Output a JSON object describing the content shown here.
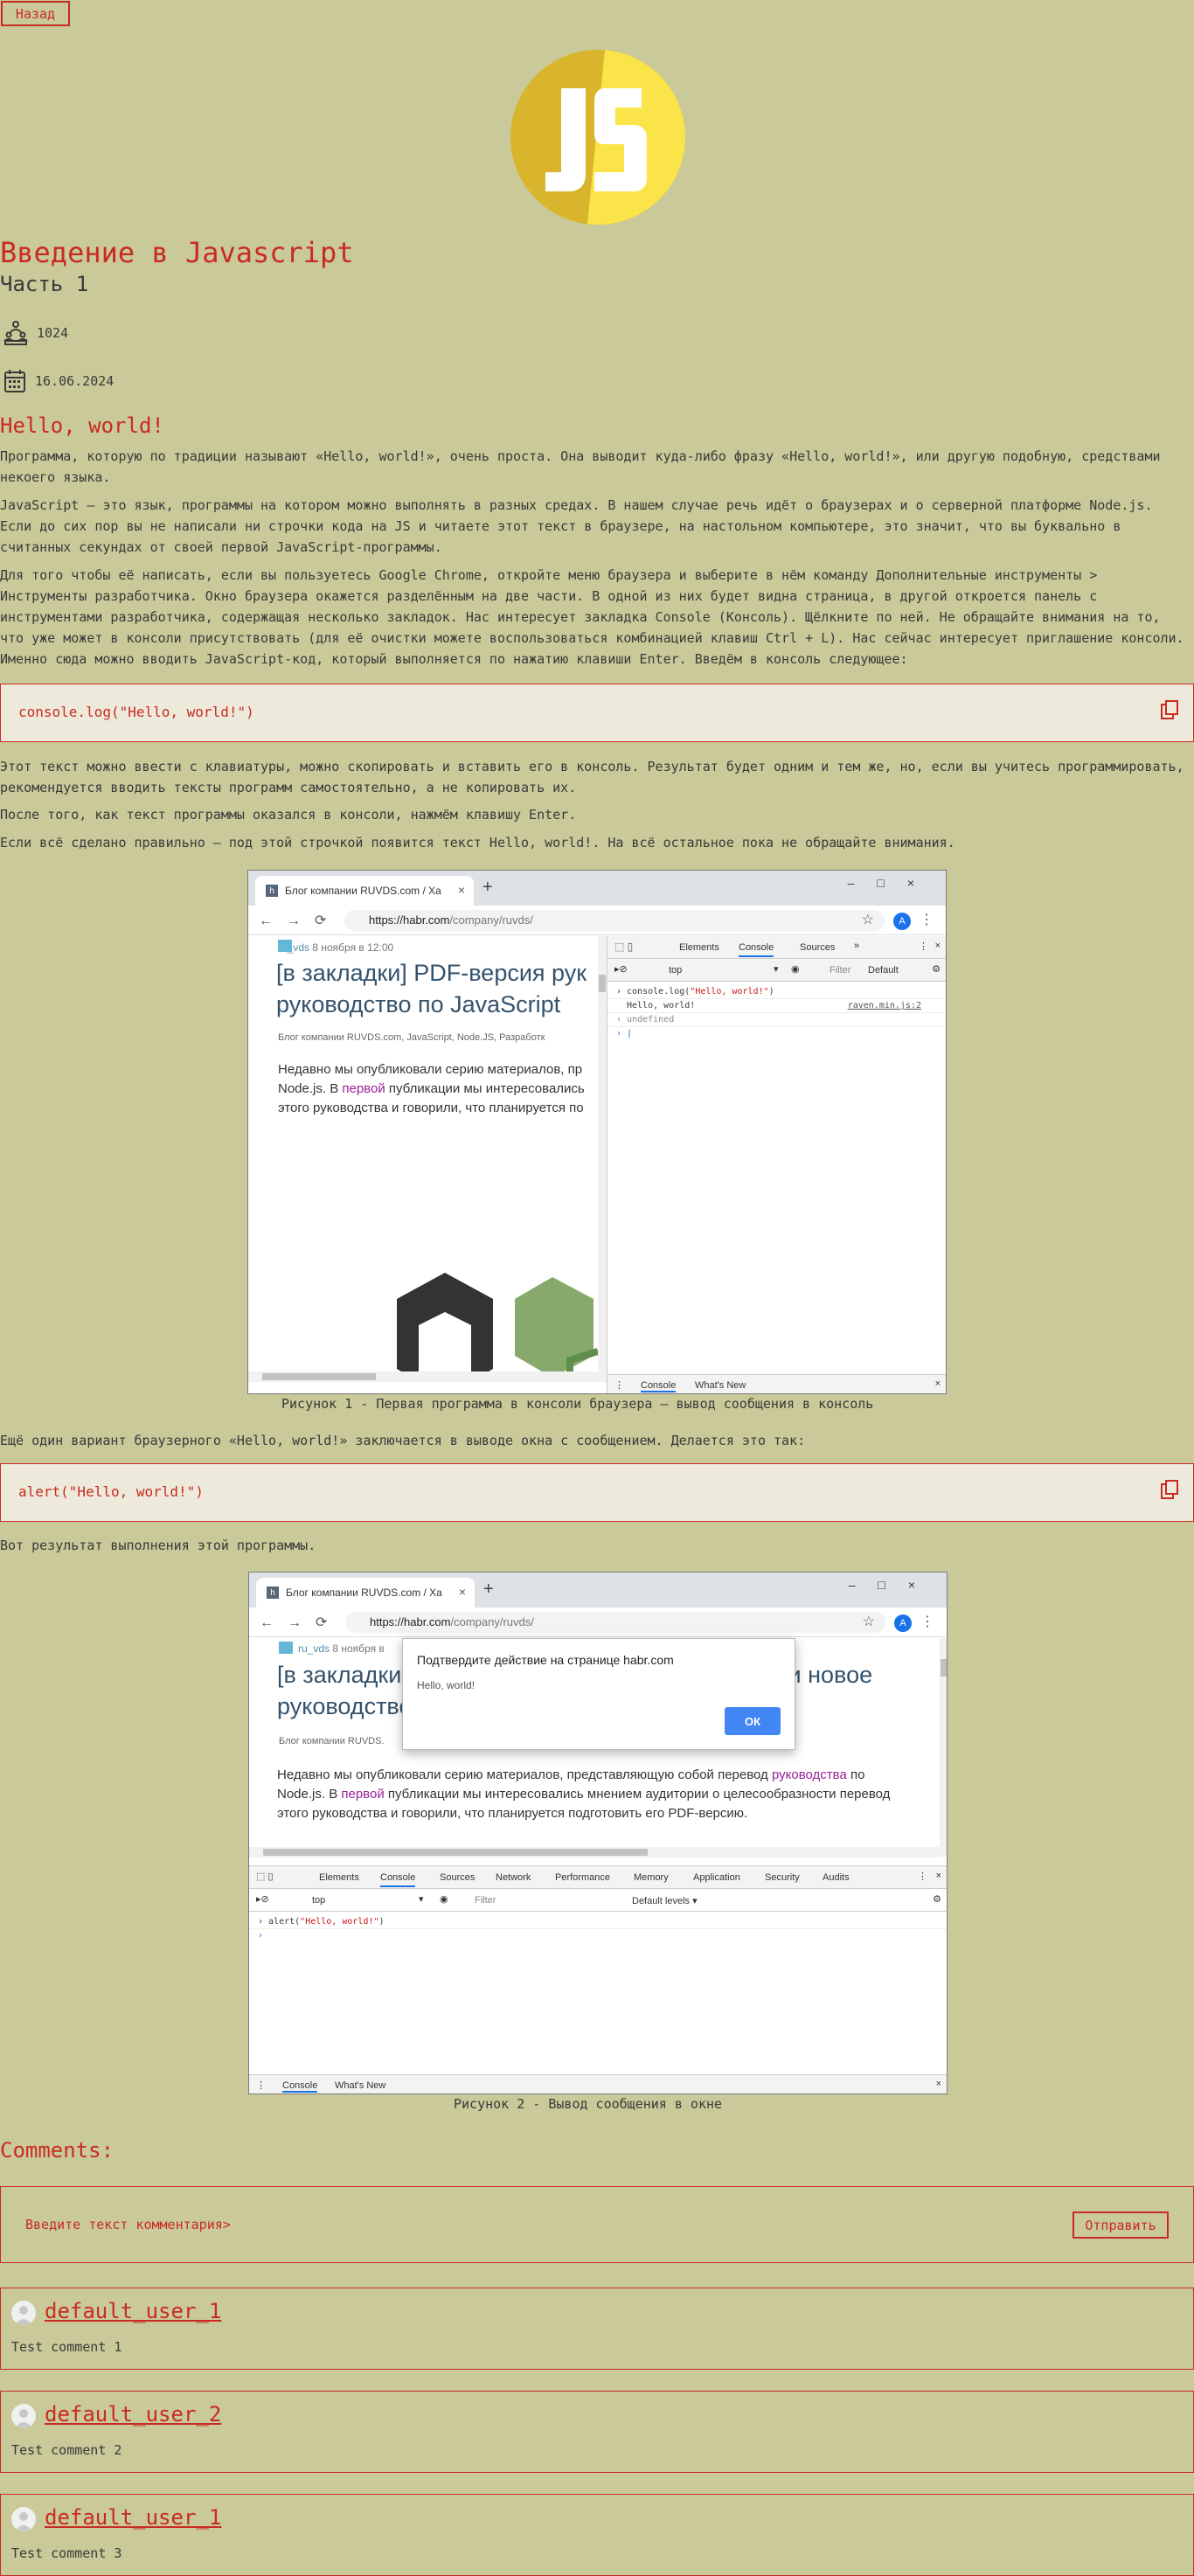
{
  "nav": {
    "back_label": "Назад"
  },
  "article": {
    "title": "Введение в Javascript",
    "subtitle": "Часть 1",
    "views": "1024",
    "date": "16.06.2024"
  },
  "logo": {
    "text": "JS",
    "colors": {
      "left": "#d8b52c",
      "right": "#fbe44a",
      "letters": "#ffffff"
    }
  },
  "section": {
    "heading": "Hello, world!",
    "p1": "Программа, которую по традиции называют «Hello, world!», очень проста. Она выводит куда-либо фразу «Hello, world!», или другую подобную, средствами некоего языка.",
    "p2": "JavaScript — это язык, программы на котором можно выполнять в разных средах. В нашем случае речь идёт о браузерах и о серверной платформе Node.js. Если до сих пор вы не написали ни строчки кода на JS и читаете этот текст в браузере, на настольном компьютере, это значит, что вы буквально в считанных секундах от своей первой JavaScript-программы.",
    "p3": "Для того чтобы её написать, если вы пользуетесь Google Chrome, откройте меню браузера и выберите в нём команду Дополнительные инструменты > Инструменты разработчика. Окно браузера окажется разделённым на две части. В одной из них будет видна страница, в другой откроется панель с инструментами разработчика, содержащая несколько закладок. Нас интересует закладка Console (Консоль). Щёлкните по ней. Не обращайте внимания на то, что уже может в консоли присутствовать (для её очистки можете воспользоваться комбинацией клавиш Ctrl + L). Нас сейчас интересует приглашение консоли. Именно сюда можно вводить JavaScript-код, который выполняется по нажатию клавиши Enter. Введём в консоль следующее:",
    "code1": "console.log(\"Hello, world!\")",
    "p4": "Этот текст можно ввести с клавиатуры, можно скопировать и вставить его в консоль. Результат будет одним и тем же, но, если вы учитесь программировать, рекомендуется вводить тексты программ самостоятельно, а не копировать их.",
    "p5": "После того, как текст программы оказался в консоли, нажмём клавишу Enter.",
    "p6": "Если всё сделано правильно — под этой строчкой появится текст Hello, world!. На всё остальное пока не обращайте внимания.",
    "caption1": "Рисунок 1 - Первая программа в консоли браузера — вывод сообщения в консоль",
    "p7": "Ещё один вариант браузерного «Hello, world!» заключается в выводе окна с сообщением. Делается это так:",
    "code2": "alert(\"Hello, world!\")",
    "p8": "Вот результат выполнения этой программы.",
    "caption2": "Рисунок 2 - Вывод сообщения в окне"
  },
  "shot1": {
    "tab_title": "Блог компании RUVDS.com / Ха",
    "url_host": "https://habr.com",
    "url_path": "/company/ruvds/",
    "account": "A",
    "author": "ru_vds",
    "post_date": "8 ноября в 12:00",
    "post_title": "[в закладки] PDF-версия рук руководство по JavaScript",
    "hubs": "Блог компании RUVDS.com,  JavaScript,  Node.JS,  Разработк",
    "body_a": "Недавно мы опубликовали серию материалов, пр",
    "body_b": "Node.js. В ",
    "body_link": "первой",
    "body_c": " публикации мы интересовались",
    "body_d": "этого руководства и говорили, что планируется по",
    "devtools_tabs": [
      "Elements",
      "Console",
      "Sources",
      "»"
    ],
    "context": "top",
    "filter": "Filter",
    "levels": "Default",
    "cmd": "console.log(",
    "cmd_str": "\"Hello, world!\"",
    "cmd_end": ")",
    "output": "Hello, world!",
    "source": "raven.min.js:2",
    "result": "undefined",
    "drawer_tabs": [
      "Console",
      "What's New"
    ]
  },
  "shot2": {
    "tab_title": "Блог компании RUVDS.com / Xa",
    "url_host": "https://habr.com",
    "url_path": "/company/ruvds/",
    "account": "A",
    "author": "ru_vds",
    "post_date": "8 ноября в",
    "post_title_a": "[в закладки",
    "post_title_b": "de.js и новое",
    "post_title_c": "руководство",
    "hubs": "Блог компании RUVDS.",
    "body_a": "Недавно мы опубликовали серию материалов, представляющую собой перевод ",
    "body_link1": "руководства",
    "body_a2": " по",
    "body_b": "Node.js. В ",
    "body_link2": "первой",
    "body_b2": " публикации мы интересовались мнением аудитории о целесообразности перевод",
    "body_c": "этого руководства и говорили, что планируется подготовить его PDF-версию.",
    "dialog_title": "Подтвердите действие на странице habr.com",
    "dialog_text": "Hello, world!",
    "dialog_ok": "ОК",
    "devtools_tabs": [
      "Elements",
      "Console",
      "Sources",
      "Network",
      "Performance",
      "Memory",
      "Application",
      "Security",
      "Audits"
    ],
    "context": "top",
    "filter": "Filter",
    "levels": "Default levels ▾",
    "cmd": "alert(",
    "cmd_str": "\"Hello, world!\"",
    "cmd_end": ")",
    "drawer_tabs": [
      "Console",
      "What's New"
    ]
  },
  "comments": {
    "heading": "Comments:",
    "placeholder": "Введите текст комментария>",
    "send_label": "Отправить",
    "items": [
      {
        "user": "default_user_1",
        "text": "Test comment 1"
      },
      {
        "user": "default_user_2",
        "text": "Test comment 2"
      },
      {
        "user": "default_user_1",
        "text": "Test comment 3"
      }
    ]
  },
  "colors": {
    "page_bg": "#c9c999",
    "accent": "#c92b22",
    "code_bg": "#edeadb"
  }
}
